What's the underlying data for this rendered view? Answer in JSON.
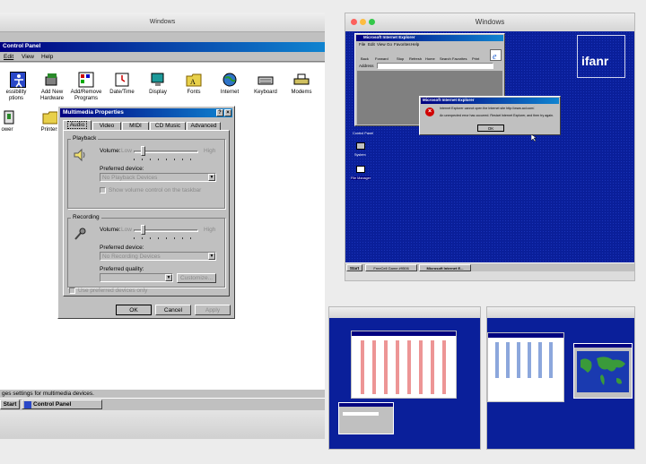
{
  "left_panel": {
    "mac_title": "Windows",
    "window_title": "Control Panel",
    "menu": [
      "Edit",
      "View",
      "Help"
    ],
    "icons_row1": [
      {
        "label": "essibility\nptions",
        "icon": "accessibility-icon"
      },
      {
        "label": "Add New\nHardware",
        "icon": "hardware-icon"
      },
      {
        "label": "Add/Remove\nPrograms",
        "icon": "programs-icon"
      },
      {
        "label": "Date/Time",
        "icon": "clock-icon"
      },
      {
        "label": "Display",
        "icon": "display-icon"
      },
      {
        "label": "Fonts",
        "icon": "fonts-folder-icon"
      },
      {
        "label": "Internet",
        "icon": "globe-icon"
      },
      {
        "label": "Keyboard",
        "icon": "keyboard-icon"
      },
      {
        "label": "Modems",
        "icon": "modem-icon"
      }
    ],
    "icons_row2": [
      {
        "label": "ower",
        "icon": "power-icon"
      },
      {
        "label": "Printers",
        "icon": "printer-folder-icon"
      }
    ],
    "status_text": "ges settings for multimedia devices.",
    "taskbar": {
      "start": "Start",
      "task": "Control Panel"
    }
  },
  "dialog": {
    "title": "Multimedia Properties",
    "tabs": [
      "Audio",
      "Video",
      "MIDI",
      "CD Music",
      "Advanced"
    ],
    "playback": {
      "group": "Playback",
      "volume_label": "Volume:",
      "low": "Low",
      "high": "High",
      "device_label": "Preferred device:",
      "device_value": "No Playback Devices",
      "checkbox": "Show volume control on the taskbar"
    },
    "recording": {
      "group": "Recording",
      "volume_label": "Volume:",
      "low": "Low",
      "high": "High",
      "device_label": "Preferred device:",
      "device_value": "No Recording Devices",
      "quality_label": "Preferred quality:",
      "customize": "Customize..."
    },
    "use_preferred": "Use preferred devices only",
    "ok": "OK",
    "cancel": "Cancel",
    "apply": "Apply"
  },
  "right_panel": {
    "mac_title": "Windows",
    "watermark": "ifanr",
    "ie_title": "Microsoft Internet Explorer",
    "ie_menu": [
      "File",
      "Edit",
      "View",
      "Go",
      "Favorites",
      "Help"
    ],
    "ie_toolbar": [
      "Back",
      "Forward",
      "Stop",
      "Refresh",
      "Home",
      "Search",
      "Favorites",
      "Print"
    ],
    "address_label": "Address",
    "error": {
      "title": "Microsoft Internet Explorer",
      "line1": "Internet Explorer cannot open the Internet site http://www.aol.com/.",
      "line2": "An unexpected error has occurred. Restart Internet Explorer, and then try again.",
      "ok": "OK"
    },
    "desktop_icons": [
      "Control Panel",
      "System",
      "File Manager"
    ],
    "taskbar": {
      "start": "Start",
      "task1": "FreeCell Game #9506",
      "task2": "Microsoft Internet E..."
    }
  },
  "colors": {
    "win_teal_navy": "#0a1f9a",
    "win_gray": "#c0c0c0",
    "titlebar": "#000080"
  }
}
